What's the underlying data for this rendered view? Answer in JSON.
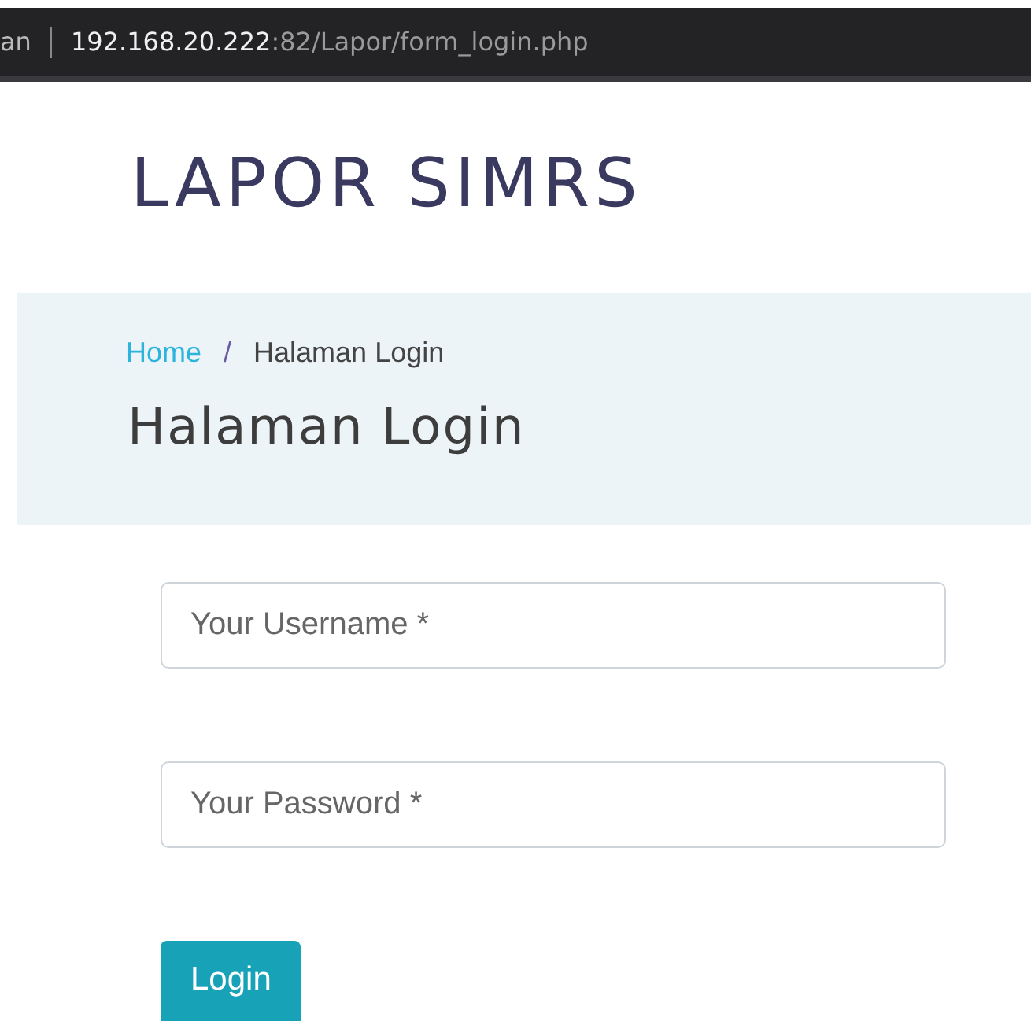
{
  "address_bar": {
    "tab_title": "an",
    "host": "192.168.20.222",
    "path": ":82/Lapor/form_login.php"
  },
  "logo": "LAPOR SIMRS",
  "breadcrumb": [
    {
      "label": "Home",
      "kind": "link"
    },
    {
      "label": "Halaman Login",
      "kind": "current"
    }
  ],
  "breadcrumb_separator": "/",
  "page_title": "Halaman Login",
  "fields": [
    {
      "placeholder": "Your Username *"
    },
    {
      "placeholder": "Your Password *"
    }
  ],
  "button": "Login"
}
